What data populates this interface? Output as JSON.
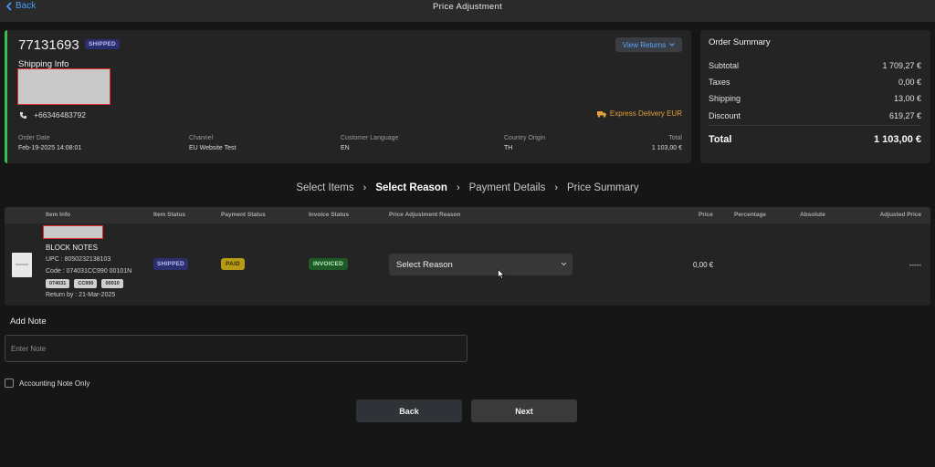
{
  "nav": {
    "back_label": "Back",
    "title": "Price Adjustment"
  },
  "order": {
    "number": "77131693",
    "status_badge": "SHIPPED",
    "view_returns_label": "View Returns",
    "shipping_info_label": "Shipping Info",
    "phone": "+66346483792",
    "delivery_method": "Express Delivery EUR",
    "meta": [
      {
        "label": "Order Date",
        "value": "Feb-19-2025 14:08:01"
      },
      {
        "label": "Channel",
        "value": "EU Website Test"
      },
      {
        "label": "Customer Language",
        "value": "EN"
      },
      {
        "label": "Country Origin",
        "value": "TH"
      },
      {
        "label": "Total",
        "value": "1 103,00 €"
      }
    ],
    "accent_color": "#36c24a"
  },
  "summary": {
    "title": "Order Summary",
    "rows": [
      {
        "label": "Subtotal",
        "value": "1 709,27 €"
      },
      {
        "label": "Taxes",
        "value": "0,00 €"
      },
      {
        "label": "Shipping",
        "value": "13,00 €"
      },
      {
        "label": "Discount",
        "value": "619,27 €"
      }
    ],
    "total_label": "Total",
    "total_value": "1 103,00 €"
  },
  "steps": {
    "items": [
      "Select Items",
      "Select Reason",
      "Payment Details",
      "Price Summary"
    ],
    "active_index": 1
  },
  "table": {
    "headers": [
      "Item Info",
      "Item Status",
      "Payment Status",
      "Invoice Status",
      "Price Adjustment Reason",
      "Price",
      "Percentage",
      "Absolute",
      "Adjusted Price"
    ],
    "row": {
      "name": "BLOCK NOTES",
      "upc": "UPC : 8050232138103",
      "code": "Code : 074031CC990 00101N",
      "chips": [
        "074031",
        "CC990",
        "00010"
      ],
      "return_by": "Return by : 21-Mar-2025",
      "item_status": "SHIPPED",
      "payment_status": "PAID",
      "invoice_status": "INVOICED",
      "reason_placeholder": "Select Reason",
      "price": "0,00 €",
      "adjusted_price": "-----"
    }
  },
  "note": {
    "label": "Add Note",
    "placeholder": "Enter Note"
  },
  "accounting": {
    "label": "Accounting Note Only",
    "checked": false
  },
  "buttons": {
    "back": "Back",
    "next": "Next"
  }
}
